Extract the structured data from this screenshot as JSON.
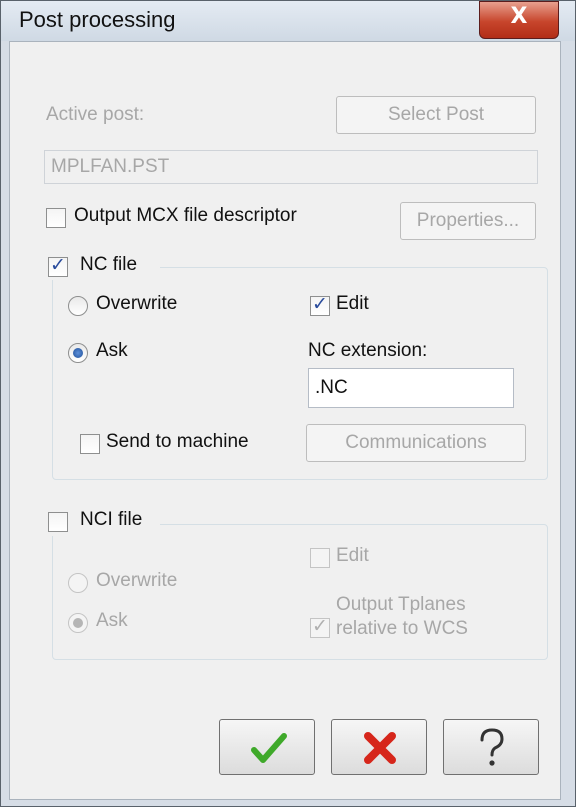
{
  "window": {
    "title": "Post processing",
    "close_glyph": "X"
  },
  "active_post": {
    "label": "Active post:",
    "select_button": "Select Post",
    "value": "MPLFAN.PST"
  },
  "mcx": {
    "label": "Output MCX file descriptor",
    "checked": false,
    "properties_button": "Properties..."
  },
  "nc_file": {
    "label": "NC file",
    "checked": true,
    "overwrite_label": "Overwrite",
    "ask_label": "Ask",
    "selected": "Ask",
    "edit_label": "Edit",
    "edit_checked": true,
    "extension_label": "NC extension:",
    "extension_value": ".NC",
    "send_label": "Send to machine",
    "send_checked": false,
    "communications_button": "Communications"
  },
  "nci_file": {
    "label": "NCI file",
    "checked": false,
    "overwrite_label": "Overwrite",
    "ask_label": "Ask",
    "selected": "Ask",
    "edit_label": "Edit",
    "edit_checked": false,
    "tplanes_line1": "Output Tplanes",
    "tplanes_line2": "relative to WCS",
    "tplanes_checked": true
  },
  "buttons": {
    "ok_icon": "check-icon",
    "cancel_icon": "x-icon",
    "help_icon": "question-icon"
  },
  "colors": {
    "ok_green": "#3fa92a",
    "cancel_red": "#d6261b",
    "title_bar": "#d6dde6"
  }
}
